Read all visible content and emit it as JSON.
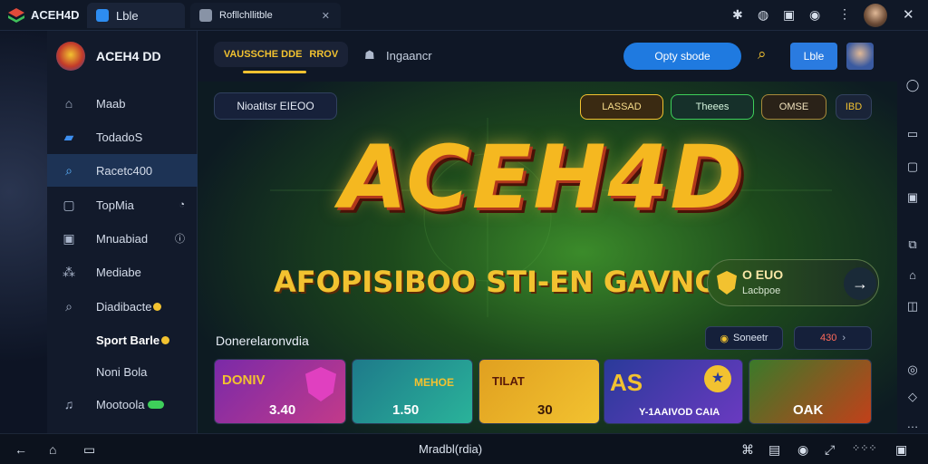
{
  "app": {
    "title": "ACEH4D",
    "tab_title": "Lble",
    "url_tab": "Rofllchllitble",
    "colors": {
      "accent": "#1f7ae0",
      "gold": "#f2c230",
      "active": "#1d3355"
    }
  },
  "sidebar": {
    "brand": "ACEH4 DD",
    "items": [
      {
        "label": "Maab",
        "icon": "home-icon"
      },
      {
        "label": "TodadoS",
        "icon": "folder-icon"
      },
      {
        "label": "Racetc400",
        "icon": "search-icon"
      },
      {
        "label": "TopMia",
        "icon": "chat-icon"
      },
      {
        "label": "Mnuabiad",
        "icon": "media-icon"
      },
      {
        "label": "Mediabe",
        "icon": "group-icon"
      },
      {
        "label": "Diadibacte",
        "icon": "search-icon"
      },
      {
        "label": "Sport Barle",
        "icon": "ball-icon"
      },
      {
        "label": "Noni Bola",
        "icon": "blank-icon"
      },
      {
        "label": "Mootoola",
        "icon": "bell-icon"
      }
    ]
  },
  "topnav": {
    "tab_active": "VAUSSCHE DDE",
    "tab_active_tag": "RROV",
    "tab_other": "Ingaancr",
    "search_label": "Opty sbode",
    "login_label": "Lble"
  },
  "hero": {
    "badge": "Nioatitsr EIEOO",
    "chips": [
      "LASSAD",
      "Theees",
      "OMSE",
      "IBD"
    ],
    "title": "ACEH4D",
    "subtitle": "AFOPISIBOO STI-EN GAVNO",
    "promo_title": "O EUO",
    "promo_sub": "Lacbpoe",
    "section_title": "Donerelaronvdia",
    "filter_1": "Soneetr",
    "filter_2": "430"
  },
  "cards": [
    {
      "label": "DONIV",
      "value": "3.40"
    },
    {
      "label": "MEHOE",
      "value": "1.50"
    },
    {
      "label": "TILAT",
      "value": "30"
    },
    {
      "label": "AS",
      "value": "Y-1AAIVOD CAIA"
    },
    {
      "label": "",
      "value": "OAK"
    }
  ],
  "bottombar": {
    "center": "Mradbl(rdia)"
  }
}
